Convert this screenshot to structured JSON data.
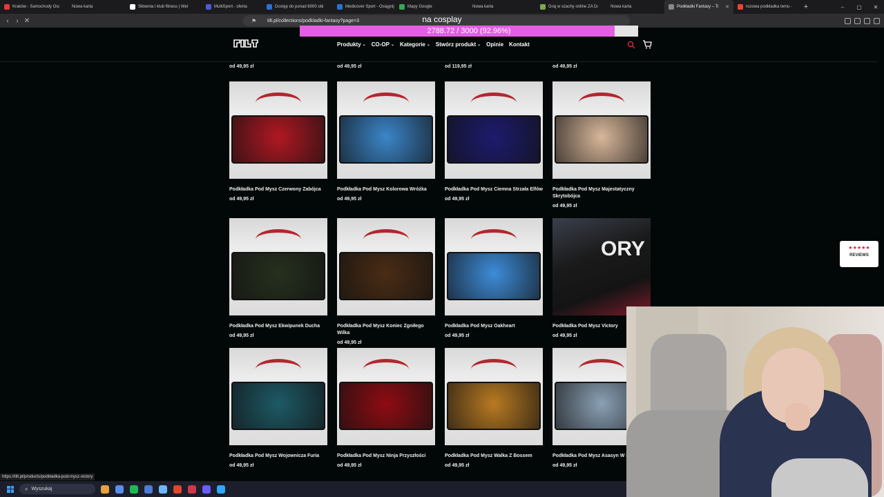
{
  "browser": {
    "tabs": [
      {
        "label": "Kraków - Samochody Osob",
        "color": "#e53935"
      },
      {
        "label": "Nowa karta",
        "color": ""
      },
      {
        "label": "Siłownia i klub fitness | Wel",
        "color": "#ffffff"
      },
      {
        "label": "MultiSport - oferta",
        "color": "#4a5bd6"
      },
      {
        "label": "Dostęp do ponad 6000 obi",
        "color": "#2f6fd6"
      },
      {
        "label": "Medicover Sport - Osiągnij",
        "color": "#2f6fd6"
      },
      {
        "label": "Mapy Google",
        "color": "#34a853"
      },
      {
        "label": "Nowa karta",
        "color": ""
      },
      {
        "label": "Graj w szachy online ZA DA",
        "color": "#7fa650"
      },
      {
        "label": "Nowa karta",
        "color": ""
      },
      {
        "label": "Podkładki Fantasy – Ti",
        "color": "#888888",
        "active": true
      },
      {
        "label": "rozowa podkładka temu - ",
        "color": "#ea4335"
      }
    ],
    "url": "tilt.pl/collections/podkladki-fantasy?page=3",
    "status_url": "https://tilt.pl/products/podkladka-pod-mysz-victory"
  },
  "overlay": {
    "title": "na cosplay",
    "progress_text": "2788.72 / 3000 (92.96%)",
    "progress_fraction": 0.9296
  },
  "site": {
    "nav": {
      "produkty": "Produkty",
      "coop": "CO-OP",
      "kategorie": "Kategorie",
      "stworz": "Stwórz produkt",
      "opinie": "Opinie",
      "kontakt": "Kontakt"
    },
    "top_prices": [
      "od 49,95 zł",
      "od 49,95 zł",
      "od 119,95 zł",
      "od 49,95 zł"
    ],
    "products": [
      {
        "name": "Podkładka Pod Mysz Czerwony Zabójca",
        "price": "od 49,95 zł",
        "art": "#b01822"
      },
      {
        "name": "Podkładka Pod Mysz Kolorowa Wróżka",
        "price": "od 49,95 zł",
        "art": "#3b86c9"
      },
      {
        "name": "Podkładka Pod Mysz Ciemna Strzała Elfów",
        "price": "od 49,95 zł",
        "art": "#1d1b6e"
      },
      {
        "name": "Podkładka Pod Mysz Majestatyczny Skrytobójca",
        "price": "od 49,95 zł",
        "art": "#d8b79a"
      },
      {
        "name": "Podkładka Pod Mysz Ekwipunek Ducha",
        "price": "od 49,95 zł",
        "art": "#26301e"
      },
      {
        "name": "Podkładka Pod Mysz Koniec Zgniłego Wilka",
        "price": "od 49,95 zł",
        "art": "#4a2c14"
      },
      {
        "name": "Podkładka Pod Mysz Oakheart",
        "price": "od 49,95 zł",
        "art": "#3d8cd8"
      },
      {
        "name": "Podkładka Pod Mysz Victory",
        "price": "od 49,95 zł",
        "art": "#1c1c1c",
        "photo": true
      },
      {
        "name": "Podkładka Pod Mysz Wojownicza Furia",
        "price": "od 49,95 zł",
        "art": "#1d5a66"
      },
      {
        "name": "Podkładka Pod Mysz Ninja Przyszłości",
        "price": "od 49,95 zł",
        "art": "#8e0c12"
      },
      {
        "name": "Podkładka Pod Mysz Walka Z Bossem",
        "price": "od 49,95 zł",
        "art": "#b87a22"
      },
      {
        "name": "Podkładka Pod Mysz Asasyn W Ba",
        "price": "od 49,95 zł",
        "art": "#8aa0b4"
      }
    ],
    "reviews": {
      "stars": "★★★★★",
      "label": "REVIEWS"
    }
  },
  "taskbar": {
    "search_placeholder": "Wyszukaj",
    "apps": [
      "#e8a23c",
      "#5b8def",
      "#1db954",
      "#4c7bd8",
      "#6bb7ff",
      "#e0462c",
      "#d1364a",
      "#6a5cff",
      "#2fa6ff"
    ]
  },
  "icons": {
    "search": "search-icon",
    "cart": "cart-icon",
    "chevron": "chevron-down-icon"
  }
}
